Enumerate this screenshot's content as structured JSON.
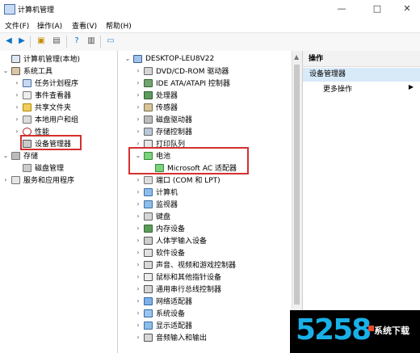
{
  "window": {
    "title": "计算机管理"
  },
  "menu": [
    "文件(F)",
    "操作(A)",
    "查看(V)",
    "帮助(H)"
  ],
  "left_tree": [
    {
      "label": "计算机管理(本地)",
      "twisty": "",
      "icon": "computer-management-icon"
    },
    {
      "label": "系统工具",
      "twisty": "⌄",
      "icon": "system-tools-icon"
    },
    {
      "label": "任务计划程序",
      "twisty": "›",
      "icon": "task-scheduler-icon"
    },
    {
      "label": "事件查看器",
      "twisty": "›",
      "icon": "event-viewer-icon"
    },
    {
      "label": "共享文件夹",
      "twisty": "›",
      "icon": "shared-folders-icon"
    },
    {
      "label": "本地用户和组",
      "twisty": "›",
      "icon": "local-users-icon"
    },
    {
      "label": "性能",
      "twisty": "›",
      "icon": "performance-icon"
    },
    {
      "label": "设备管理器",
      "twisty": "",
      "icon": "device-manager-icon"
    },
    {
      "label": "存储",
      "twisty": "⌄",
      "icon": "storage-icon"
    },
    {
      "label": "磁盘管理",
      "twisty": "",
      "icon": "disk-management-icon"
    },
    {
      "label": "服务和应用程序",
      "twisty": "›",
      "icon": "services-icon"
    }
  ],
  "device_tree": [
    {
      "label": "DESKTOP-LEU8V22",
      "twisty": "⌄",
      "icon": "computer-icon"
    },
    {
      "label": "DVD/CD-ROM 驱动器",
      "twisty": "›",
      "icon": "dvd-drive-icon"
    },
    {
      "label": "IDE ATA/ATAPI 控制器",
      "twisty": "›",
      "icon": "ide-controller-icon"
    },
    {
      "label": "处理器",
      "twisty": "›",
      "icon": "processor-icon"
    },
    {
      "label": "传感器",
      "twisty": "›",
      "icon": "sensor-icon"
    },
    {
      "label": "磁盘驱动器",
      "twisty": "›",
      "icon": "disk-drive-icon"
    },
    {
      "label": "存储控制器",
      "twisty": "›",
      "icon": "storage-controller-icon"
    },
    {
      "label": "打印队列",
      "twisty": "›",
      "icon": "printer-icon"
    },
    {
      "label": "电池",
      "twisty": "⌄",
      "icon": "battery-icon"
    },
    {
      "label": "Microsoft AC 适配器",
      "twisty": "",
      "icon": "ac-adapter-icon"
    },
    {
      "label": "端口 (COM 和 LPT)",
      "twisty": "›",
      "icon": "port-icon"
    },
    {
      "label": "计算机",
      "twisty": "›",
      "icon": "computer-small-icon"
    },
    {
      "label": "监视器",
      "twisty": "›",
      "icon": "monitor-icon"
    },
    {
      "label": "键盘",
      "twisty": "›",
      "icon": "keyboard-icon"
    },
    {
      "label": "内存设备",
      "twisty": "›",
      "icon": "memory-icon"
    },
    {
      "label": "人体学输入设备",
      "twisty": "›",
      "icon": "hid-icon"
    },
    {
      "label": "软件设备",
      "twisty": "›",
      "icon": "software-device-icon"
    },
    {
      "label": "声音、视频和游戏控制器",
      "twisty": "›",
      "icon": "sound-icon"
    },
    {
      "label": "鼠标和其他指针设备",
      "twisty": "›",
      "icon": "mouse-icon"
    },
    {
      "label": "通用串行总线控制器",
      "twisty": "›",
      "icon": "usb-icon"
    },
    {
      "label": "网络适配器",
      "twisty": "›",
      "icon": "network-adapter-icon"
    },
    {
      "label": "系统设备",
      "twisty": "›",
      "icon": "system-device-icon"
    },
    {
      "label": "显示适配器",
      "twisty": "›",
      "icon": "display-adapter-icon"
    },
    {
      "label": "音频输入和输出",
      "twisty": "›",
      "icon": "audio-io-icon"
    }
  ],
  "actions": {
    "header": "操作",
    "selected": "设备管理器",
    "more": "更多操作"
  },
  "watermark": {
    "number": "5258",
    "site": "系统下载"
  },
  "colors": {
    "highlight": "#d52f2f",
    "selection": "#d8e9f8",
    "brand": "#19b0e8"
  }
}
